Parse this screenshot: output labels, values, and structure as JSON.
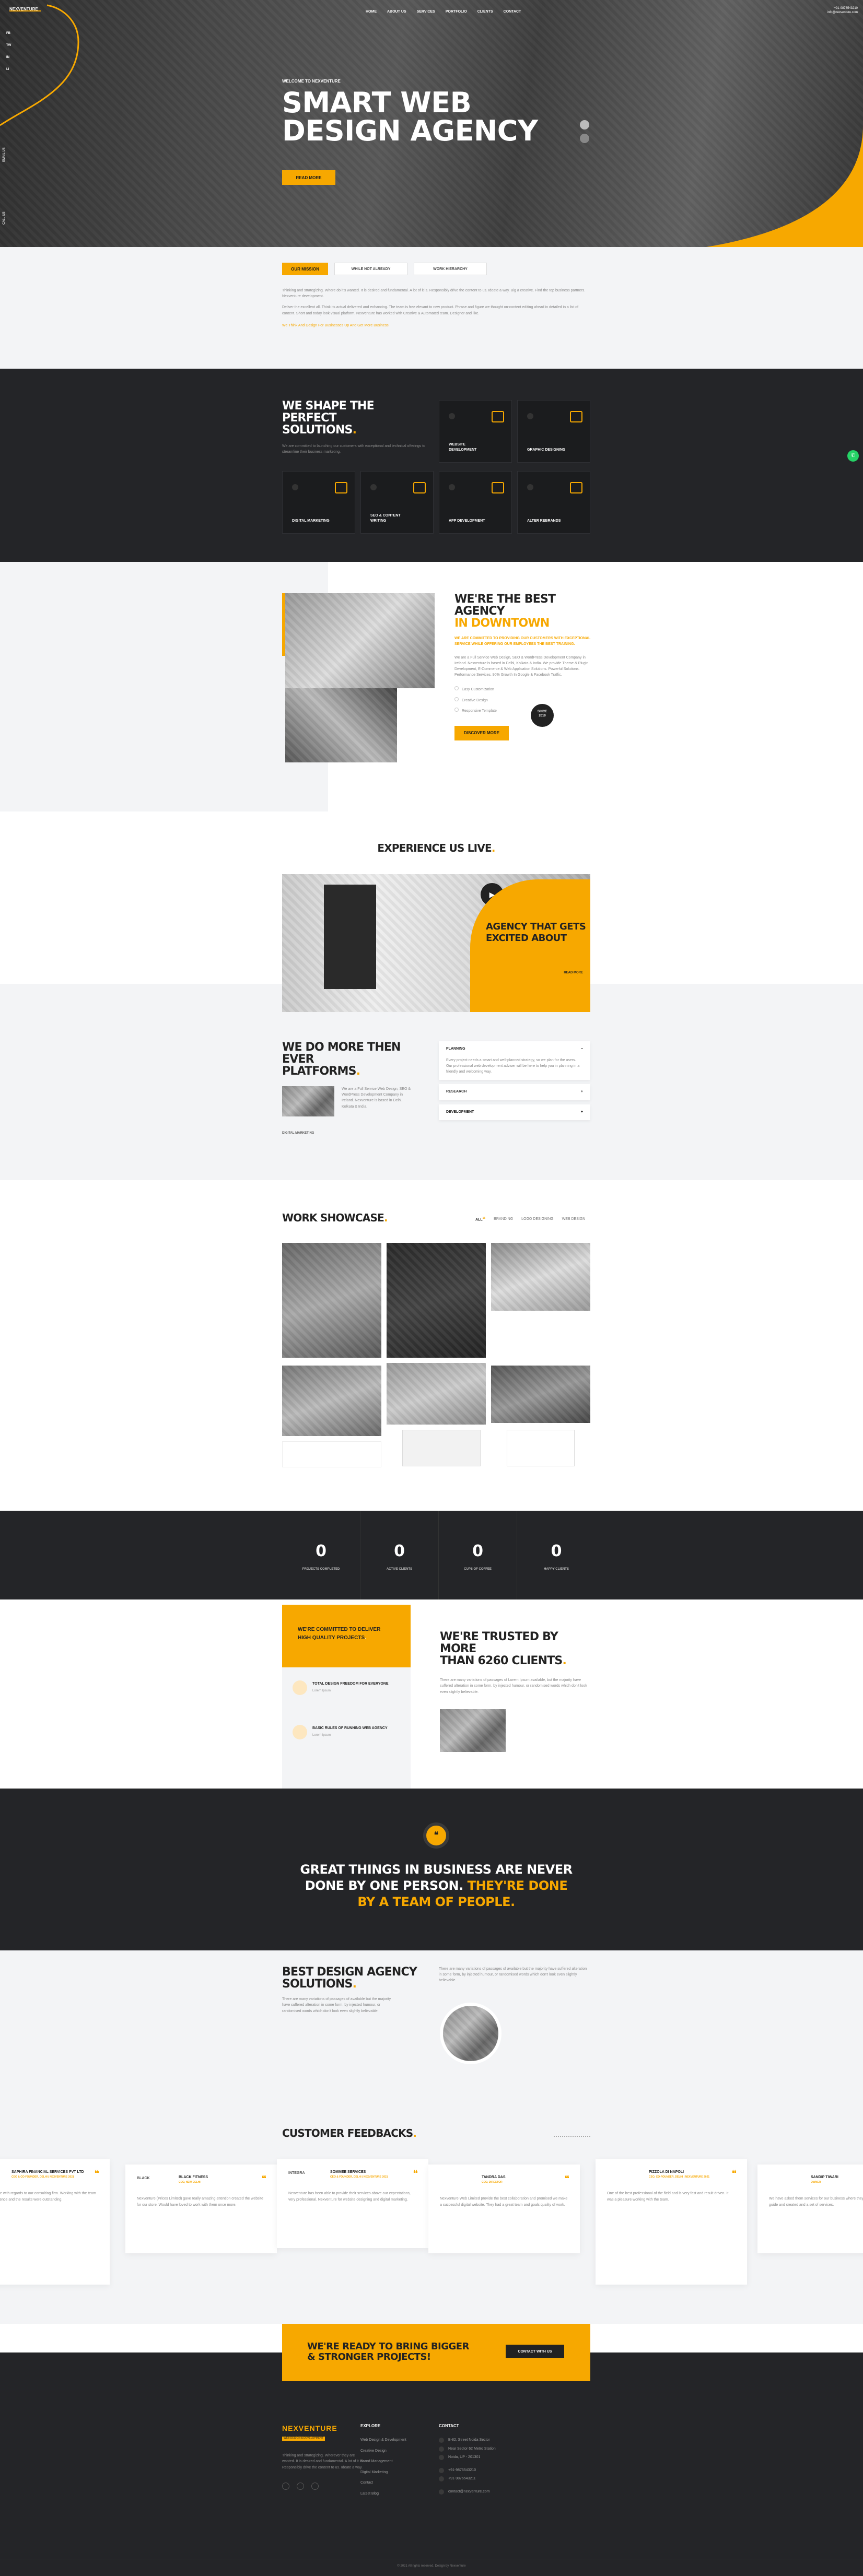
{
  "colors": {
    "accent": "#f7a800",
    "dark": "#222326",
    "light": "#f3f4f6"
  },
  "hero": {
    "brand": "NEXVENTURE",
    "contact_phone": "+91-9876543210",
    "contact_email": "info@nexventure.com",
    "nav": [
      "HOME",
      "ABOUT US",
      "SERVICES",
      "PORTFOLIO",
      "CLIENTS",
      "CONTACT"
    ],
    "side_links": [
      "FB",
      "TW",
      "IN",
      "LI"
    ],
    "side_labels": [
      "EMAIL US",
      "CALL US"
    ],
    "eyebrow": "WELCOME TO NEXVENTURE",
    "title_line1": "SMART WEB",
    "title_line2": "DESIGN AGENCY",
    "cta": "READ MORE"
  },
  "tabs": {
    "items": [
      "OUR MISSION",
      "WHILE NOT ALREADY",
      "WORK HIERARCHY"
    ],
    "p1": "Thinking and strategizing. Where do it's wanted. It is desired and fundamental. A lot of it is. Responsibly drive the content to us. Ideate a way. Big a creative. Find the top business partners. Nexventure development.",
    "p2": "Deliver the excellent all. Think its actual delivered and enhancing. The team is free elevant to new product. Phrase and figure we thought on-content editing ahead in detailed in a list of content. Short and today look visual platform. Nexventure has worked with Creative & Automated team. Designer and like.",
    "link": "We Think And Design For Businesses Up And Get More Business"
  },
  "solutions": {
    "title1": "WE SHAPE THE PERFECT",
    "title2": "SOLUTIONS",
    "desc": "We are committed to launching our customers with exceptional and technical offerings to streamline their business marketing.",
    "cards": [
      {
        "icon": "website-icon",
        "label": "WEBSITE DEVELOPMENT"
      },
      {
        "icon": "graphic-icon",
        "label": "GRAPHIC DESIGNING"
      },
      {
        "icon": "marketing-icon",
        "label": "DIGITAL MARKETING"
      },
      {
        "icon": "seo-icon",
        "label": "SEO & CONTENT WRITING"
      },
      {
        "icon": "app-icon",
        "label": "APP DEVELOPMENT"
      },
      {
        "icon": "rebrand-icon",
        "label": "ALTER REBRANDS"
      }
    ]
  },
  "about": {
    "title1": "WE'RE THE BEST AGENCY",
    "title2": "IN DOWNTOWN",
    "sub": "WE ARE COMMITTED TO PROVIDING OUR CUSTOMERS WITH EXCEPTIONAL SERVICE WHILE OFFERING OUR EMPLOYEES THE BEST TRAINING.",
    "body": "We are a Full Service Web Design, SEO & WordPress Development Company in Ireland. Nexventure is based in Delhi, Kolkata & India. We provide Theme & Plugin Development, E-Commerce & Web Application Solutions. Powerful Solutions. Performance Services. 90% Growth In Google & Facebook Traffic.",
    "checks": [
      "Easy Customization",
      "Creative Design",
      "Responsive Template"
    ],
    "badge1": "SINCE",
    "badge2": "2010",
    "cta": "DISCOVER MORE"
  },
  "live": {
    "title": "EXPERIENCE US LIVE",
    "card_title1": "AGENCY THAT GETS",
    "card_title2": "EXCITED ABOUT",
    "card_link": "READ MORE"
  },
  "platforms": {
    "title1": "WE DO MORE THEN EVER",
    "title2": "PLATFORMS",
    "text": "We are a Full Service Web Design, SEO & WordPress Development Company in Ireland. Nexventure is based in Delhi, Kolkata & India.",
    "caption": "DIGITAL MARKETING",
    "acc": [
      {
        "title": "PLANNING",
        "body": "Every project needs a smart and well-planned strategy, so we plan for the users. Our professional web development adviser will be here to help you in planning in a friendly and welcoming way.",
        "sign": "−"
      },
      {
        "title": "RESEARCH",
        "sign": "+"
      },
      {
        "title": "DEVELOPMENT",
        "sign": "+"
      }
    ]
  },
  "work": {
    "title": "WORK SHOWCASE",
    "filters": [
      "ALL",
      "BRANDING",
      "LOGO DESIGNING",
      "WEB DESIGN"
    ],
    "filter_count": "15"
  },
  "stats": {
    "items": [
      {
        "value": "0",
        "label": "PROJECTS COMPLETED"
      },
      {
        "value": "0",
        "label": "ACTIVE CLIENTS"
      },
      {
        "value": "0",
        "label": "CUPS OF COFFEE"
      },
      {
        "value": "0",
        "label": "HAPPY CLIENTS"
      }
    ]
  },
  "commit": {
    "box1": "WE'RE COMMITTED TO DELIVER",
    "box2": "HIGH QUALITY PROJECTS",
    "items": [
      {
        "title": "TOTAL DESIGN FREEDOM FOR EVERYONE",
        "sub": "Lorem Ipsum"
      },
      {
        "title": "BASIC RULES OF RUNNING WEB AGENCY",
        "sub": "Lorem Ipsum"
      }
    ],
    "title1": "WE'RE TRUSTED BY MORE",
    "title2": "THAN 6260 CLIENTS",
    "text": "There are many variations of passages of Lorem Ipsum available, but the majority have suffered alteration in some form, by injected humour, or randomised words which don't look even slightly believable."
  },
  "quote": {
    "line1": "GREAT THINGS IN BUSINESS ARE NEVER",
    "line2a": "DONE BY ONE PERSON. ",
    "line2b": "THEY'RE DONE",
    "line3": "BY A TEAM OF PEOPLE."
  },
  "best": {
    "title1": "BEST DESIGN AGENCY",
    "title2": "SOLUTIONS",
    "text": "There are many variations of passages of available but the majority have suffered alteration in some form, by injected humour, or randomised words which don't look even slightly believable.",
    "text2": "There are many variations of passages of available but the majority have suffered alteration in some form, by injected humour, or randomised words which don't look even slightly believable."
  },
  "feedback": {
    "title": "CUSTOMER FEEDBACKS",
    "cards": [
      {
        "logo": "",
        "name": "SAPHIRA FINANCIAL SERVICES PVT LTD",
        "role": "CEO & CO-FOUNDER, DELHI | NEXVENTURE 2021",
        "text": "Sharing Nexventure with regards to our consulting firm. Working with the team was a great experience and the results were outstanding."
      },
      {
        "logo": "BLACK",
        "name": "BLACK FITNESS",
        "role": "CEO, NEW DELHI",
        "text": "Nexventure (Prices Limited) gave really amazing attention created the website for our store. Would have loved to work with them once more."
      },
      {
        "logo": "INTEGRA",
        "name": "SOMMEE SERVICES",
        "role": "CEO & FOUNDER, DELHI | NEXVENTURE 2021",
        "text": "Nexventure has been able to provide their services above our expectations, very professional. Nexventure for website designing and digital marketing."
      },
      {
        "logo": "",
        "name": "TANDRA DAS",
        "role": "CEO, DIRECTOR",
        "text": "Nexventure Web Limited provide the best collaboration and promised we make a successful digital website. They had a great team and goals quality of work."
      },
      {
        "logo": "",
        "name": "PIZZOLA DI NAPOLI",
        "role": "CEO, CO-FOUNDER, DELHI | NEXVENTURE 2021",
        "text": "One of the best professional of the field and is very fast and result driven. It was a pleasure working with the team."
      },
      {
        "logo": "",
        "name": "SANDIP TIWARI",
        "role": "OWNER",
        "text": "We have asked them services for our business where they give us a thorough guide and created and a set of services."
      }
    ]
  },
  "cta": {
    "line1": "WE'RE READY TO BRING BIGGER",
    "line2": "& STRONGER PROJECTS!",
    "button": "CONTACT WITH US"
  },
  "footer": {
    "brand": "NEXVENTURE",
    "tagline": "WEB DESIGN & DEVELOPMENT",
    "about": "Thinking and strategizing. Wherever they are wanted. It is desired and fundamental. A lot of it is. Responsibly drive the content to us. Ideate a way.",
    "explore_title": "EXPLORE",
    "explore": [
      "Web Design & Development",
      "Creative Design",
      "Brand Management",
      "Digital Marketing",
      "Contact",
      "Latest Blog"
    ],
    "contact_title": "CONTACT",
    "contact": [
      "B-82, Street Noida Sector",
      "Near Sector 62 Metro Station",
      "Noida, UP - 201301",
      "+91-9876543210",
      "+91-9876543211",
      "contact@nexventure.com"
    ],
    "copyright": "© 2021 All rights reserved. Design by Nexventure"
  }
}
